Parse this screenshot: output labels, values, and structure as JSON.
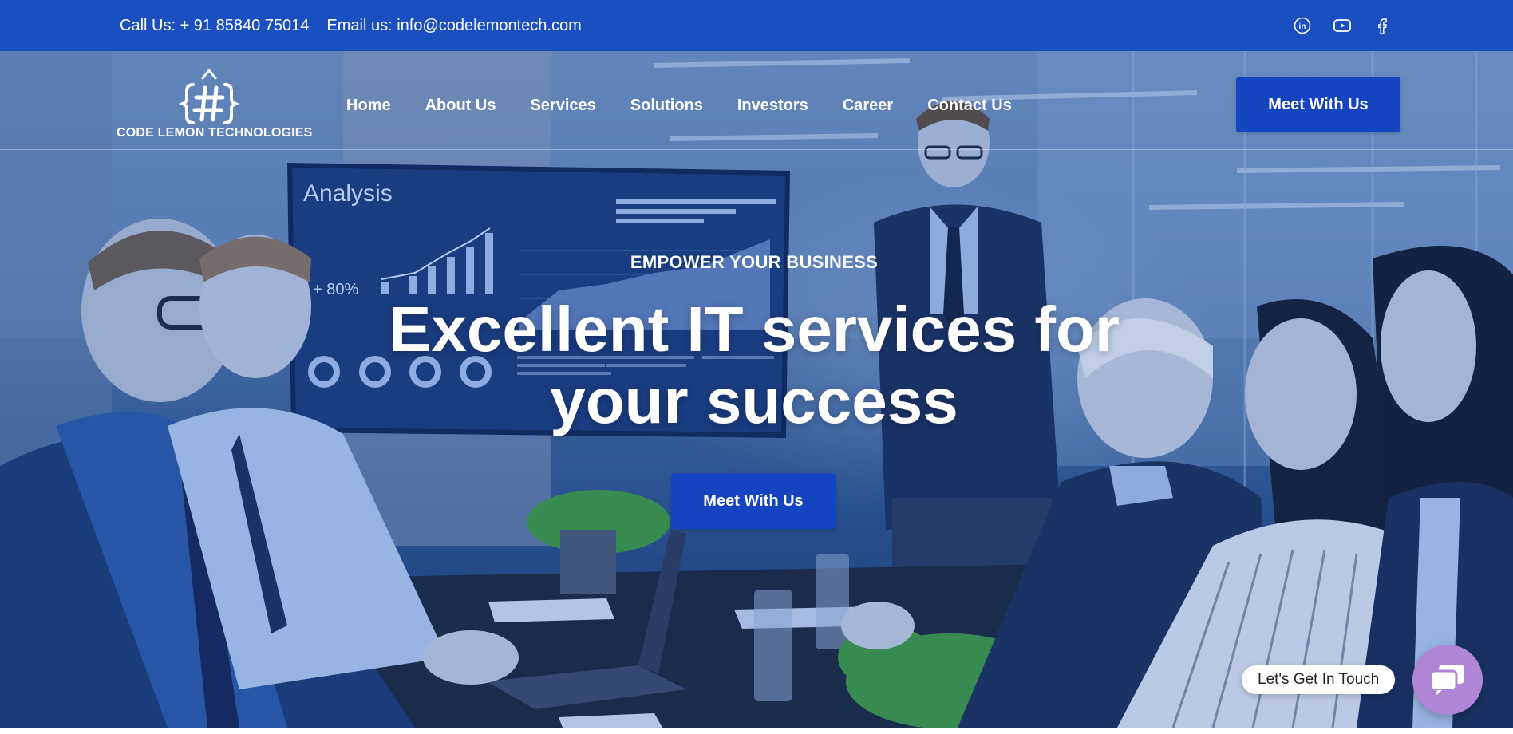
{
  "topbar": {
    "phone": "Call Us: + 91 85840 75014",
    "email": "Email us: info@codelemontech.com",
    "social": [
      "linkedin-icon",
      "youtube-icon",
      "facebook-icon"
    ],
    "bg_color": "#1a4fc0"
  },
  "brand": {
    "logo_symbol": "{#}",
    "name": "CODE LEMON TECHNOLOGIES"
  },
  "nav": {
    "items": [
      "Home",
      "About Us",
      "Services",
      "Solutions",
      "Investors",
      "Career",
      "Contact Us"
    ],
    "cta_label": "Meet With Us"
  },
  "hero": {
    "kicker": "EMPOWER YOUR BUSINESS",
    "headline_line1": "Excellent IT services for",
    "headline_line2": "your success",
    "cta_label": "Meet With Us",
    "screen": {
      "title": "Analysis",
      "stat": "+ 80%"
    }
  },
  "chat": {
    "label": "Let's Get In Touch",
    "icon": "chat-icon",
    "color": "#b085d6"
  },
  "colors": {
    "accent": "#1444c0"
  }
}
